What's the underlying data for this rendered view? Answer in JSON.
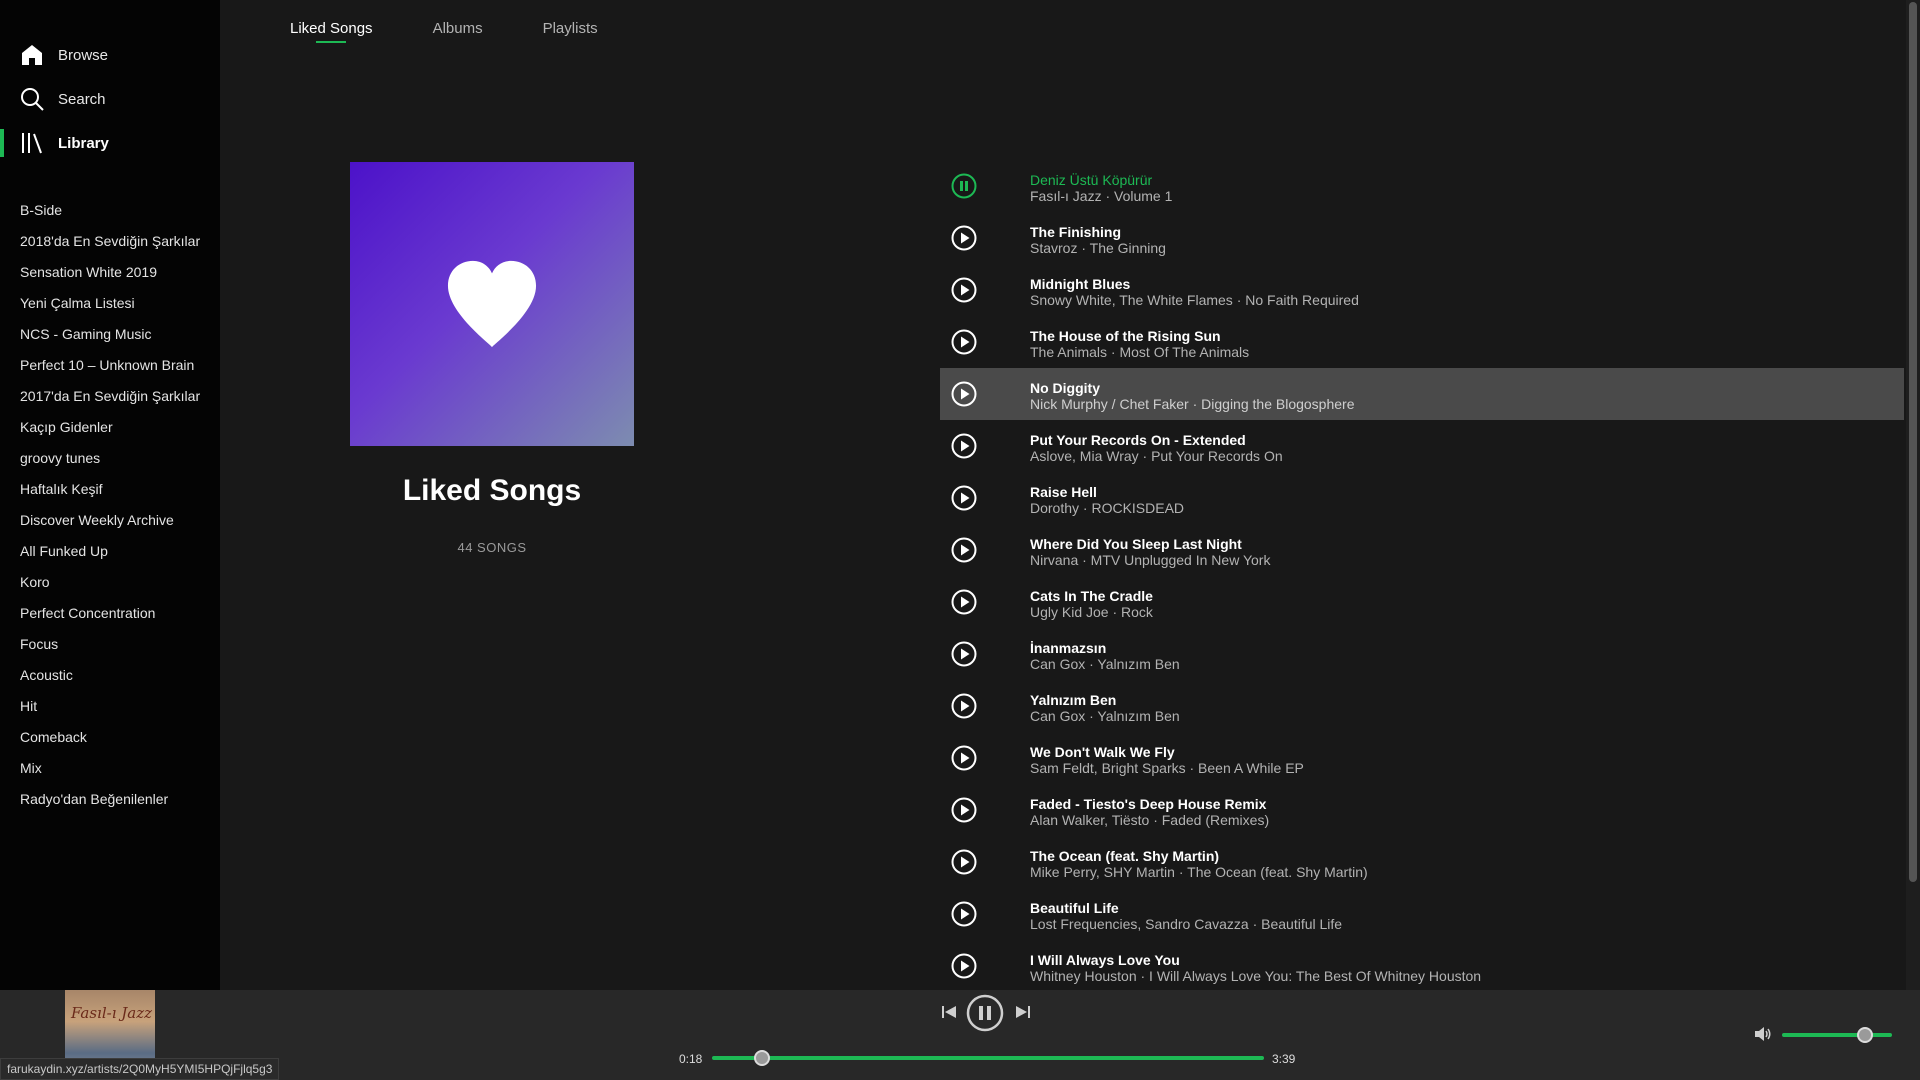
{
  "nav": {
    "browse": "Browse",
    "search": "Search",
    "library": "Library"
  },
  "playlists": [
    "B-Side",
    "2018'da En Sevdiğin Şarkılar",
    "Sensation White 2019",
    "Yeni Çalma Listesi",
    "NCS - Gaming Music",
    "Perfect 10 – Unknown Brain",
    "2017'da En Sevdiğin Şarkılar",
    "Kaçıp Gidenler",
    "groovy tunes",
    "Haftalık Keşif",
    "Discover Weekly Archive",
    "All Funked Up",
    "Koro",
    "Perfect Concentration",
    "Focus",
    "Acoustic",
    "Hit",
    "Comeback",
    "Mix",
    "Radyo'dan Beğenilenler"
  ],
  "tabs": [
    "Liked Songs",
    "Albums",
    "Playlists"
  ],
  "active_tab": "Liked Songs",
  "cover": {
    "title": "Liked Songs",
    "count": "44 SONGS"
  },
  "tracks": [
    {
      "title": "Deniz Üstü Köpürür",
      "subtitle": "Fasıl-ı Jazz · Volume 1",
      "state": "playing"
    },
    {
      "title": "The Finishing",
      "subtitle": "Stavroz · The Ginning"
    },
    {
      "title": "Midnight Blues",
      "subtitle": "Snowy White, The White Flames · No Faith Required"
    },
    {
      "title": "The House of the Rising Sun",
      "subtitle": "The Animals · Most Of The Animals"
    },
    {
      "title": "No Diggity",
      "subtitle": "Nick Murphy / Chet Faker · Digging the Blogosphere",
      "state": "hover"
    },
    {
      "title": "Put Your Records On - Extended",
      "subtitle": "Aslove, Mia Wray · Put Your Records On"
    },
    {
      "title": "Raise Hell",
      "subtitle": "Dorothy · ROCKISDEAD"
    },
    {
      "title": "Where Did You Sleep Last Night",
      "subtitle": "Nirvana · MTV Unplugged In New York"
    },
    {
      "title": "Cats In The Cradle",
      "subtitle": "Ugly Kid Joe · Rock"
    },
    {
      "title": "İnanmazsın",
      "subtitle": "Can Gox · Yalnızım Ben"
    },
    {
      "title": "Yalnızım Ben",
      "subtitle": "Can Gox · Yalnızım Ben"
    },
    {
      "title": "We Don't Walk We Fly",
      "subtitle": "Sam Feldt, Bright Sparks · Been A While EP"
    },
    {
      "title": "Faded - Tiesto's Deep House Remix",
      "subtitle": "Alan Walker, Tiësto · Faded (Remixes)"
    },
    {
      "title": "The Ocean (feat. Shy Martin)",
      "subtitle": "Mike Perry, SHY Martin · The Ocean (feat. Shy Martin)"
    },
    {
      "title": "Beautiful Life",
      "subtitle": "Lost Frequencies, Sandro Cavazza · Beautiful Life"
    },
    {
      "title": "I Will Always Love You",
      "subtitle": "Whitney Houston · I Will Always Love You: The Best Of Whitney Houston"
    }
  ],
  "player": {
    "album_art_text": "Fasıl-ı Jazz",
    "elapsed": "0:18",
    "duration": "3:39",
    "progress": 0.09,
    "volume": 0.75
  },
  "status_url": "farukaydin.xyz/artists/2Q0MyH5YMI5HPQjFjlq5g3",
  "colors": {
    "accent": "#1db954",
    "sidebar_bg": "#040404",
    "main_bg": "#181818",
    "player_bg": "#282828",
    "hover_row": "#4a4a4a"
  },
  "icons": {
    "browse": "home-icon",
    "search": "search-icon",
    "library": "library-icon",
    "liked": "heart-icon",
    "track_play": "play-circle-icon",
    "track_playing": "pause-circle-icon",
    "prev": "skip-previous-icon",
    "play_pause": "pause-circle-icon",
    "next": "skip-next-icon",
    "volume": "volume-icon"
  }
}
